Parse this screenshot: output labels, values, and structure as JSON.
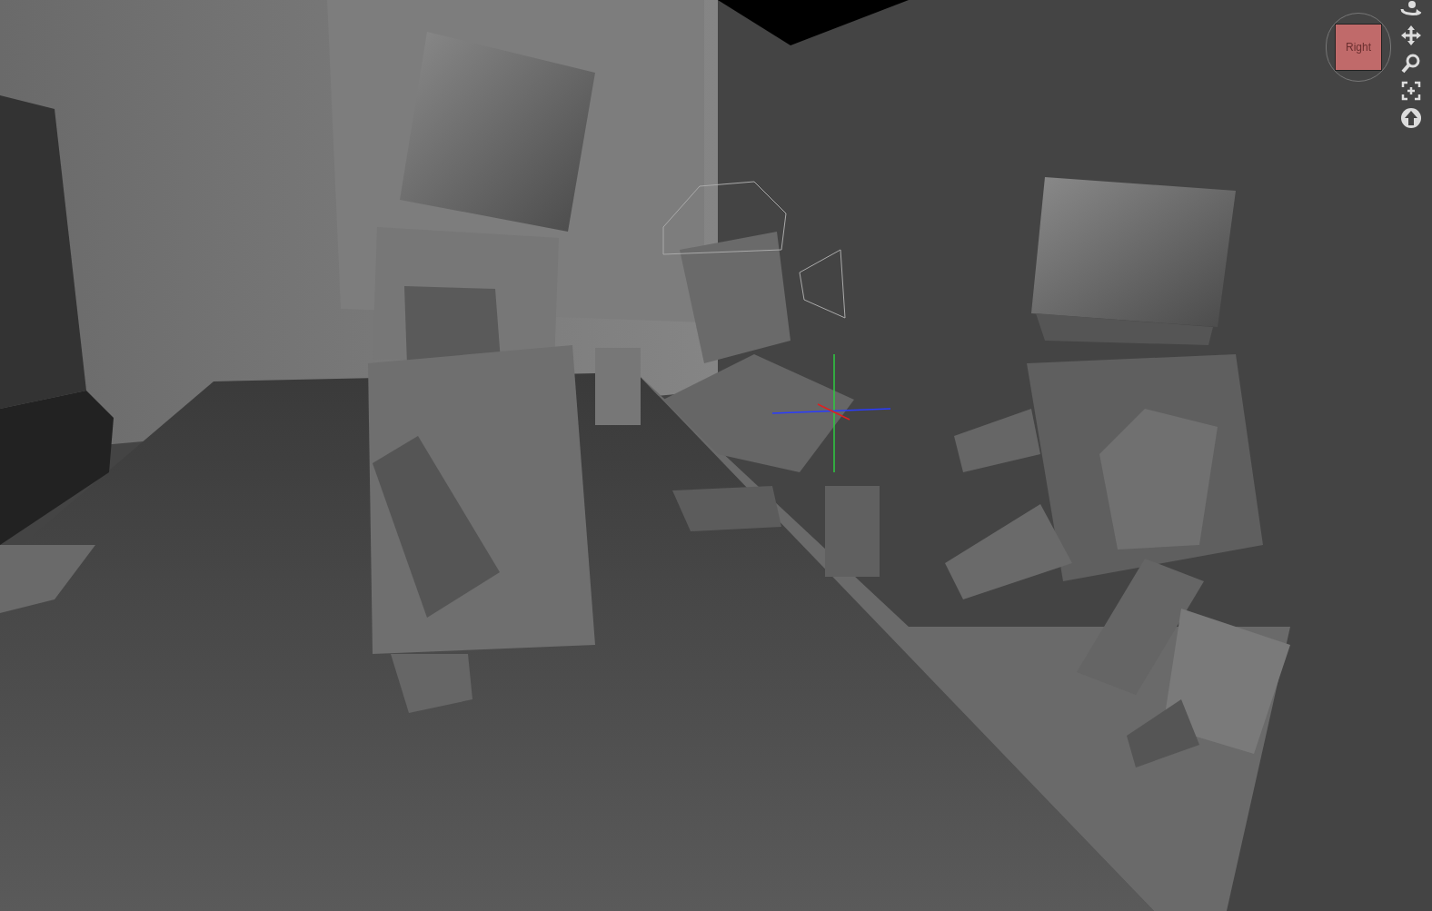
{
  "viewport": {
    "view_cube": {
      "face_label": "Right"
    }
  }
}
